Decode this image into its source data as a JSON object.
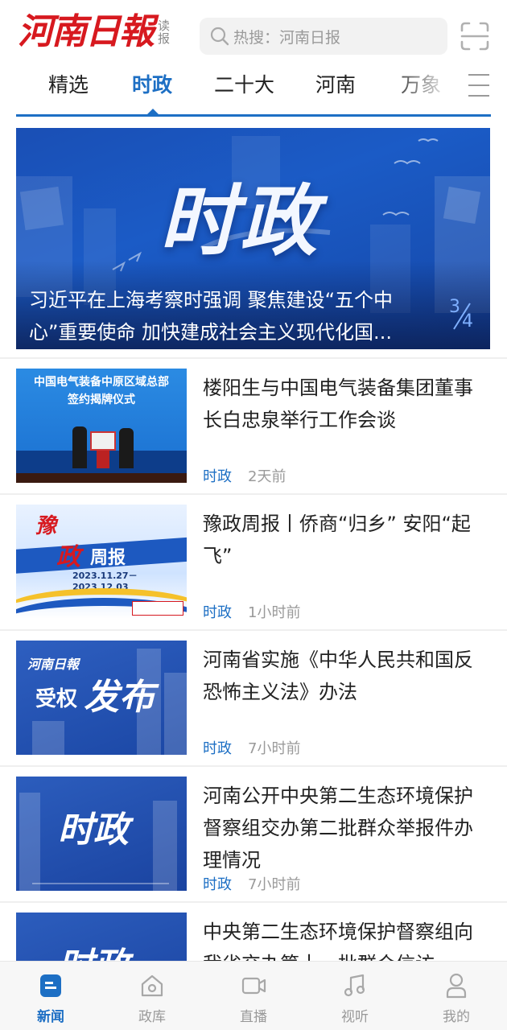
{
  "header": {
    "logo": "河南日報",
    "logo_sub_line1": "读",
    "logo_sub_line2": "报",
    "search_placeholder": "热搜：河南日报",
    "accent_color": "#d7191f"
  },
  "tabs": {
    "items": [
      "精选",
      "时政",
      "二十大",
      "河南",
      "万象"
    ],
    "active_index": 1,
    "active_color": "#1d6fc4"
  },
  "hero": {
    "big_text": "时政",
    "caption": "习近平在上海考察时强调 聚焦建设“五个中心”重要使命 加快建成社会主义现代化国...",
    "counter_current": "3",
    "counter_total": "4"
  },
  "articles": [
    {
      "title": "楼阳生与中国电气装备集团董事长白忠泉举行工作会谈",
      "category": "时政",
      "time": "2天前",
      "thumb_text_line1": "中国电气装备中原区域总部",
      "thumb_text_line2": "签约揭牌仪式"
    },
    {
      "title": "豫政周报丨侨商“归乡” 安阳“起飞”",
      "category": "时政",
      "time": "1小时前",
      "thumb_yu": "豫",
      "thumb_zheng": "政",
      "thumb_zhoubao": "周报",
      "thumb_date": "2023.11.27－2023.12.03"
    },
    {
      "title": "河南省实施《中华人民共和国反恐怖主义法》办法",
      "category": "时政",
      "time": "7小时前",
      "thumb_logo": "河南日報",
      "thumb_shouquan": "受权",
      "thumb_fabu": "发布"
    },
    {
      "title": "河南公开中央第二生态环境保护督察组交办第二批群众举报件办理情况",
      "category": "时政",
      "time": "7小时前",
      "thumb_text": "时政"
    },
    {
      "title": "中央第二生态环境保护督察组向我省交办第十一批群众信访",
      "category": "",
      "time": "",
      "thumb_text": "时政"
    }
  ],
  "bottom_nav": {
    "items": [
      {
        "label": "新闻",
        "icon": "news-icon"
      },
      {
        "label": "政库",
        "icon": "library-icon"
      },
      {
        "label": "直播",
        "icon": "live-icon"
      },
      {
        "label": "视听",
        "icon": "music-icon"
      },
      {
        "label": "我的",
        "icon": "profile-icon"
      }
    ],
    "active_index": 0
  }
}
